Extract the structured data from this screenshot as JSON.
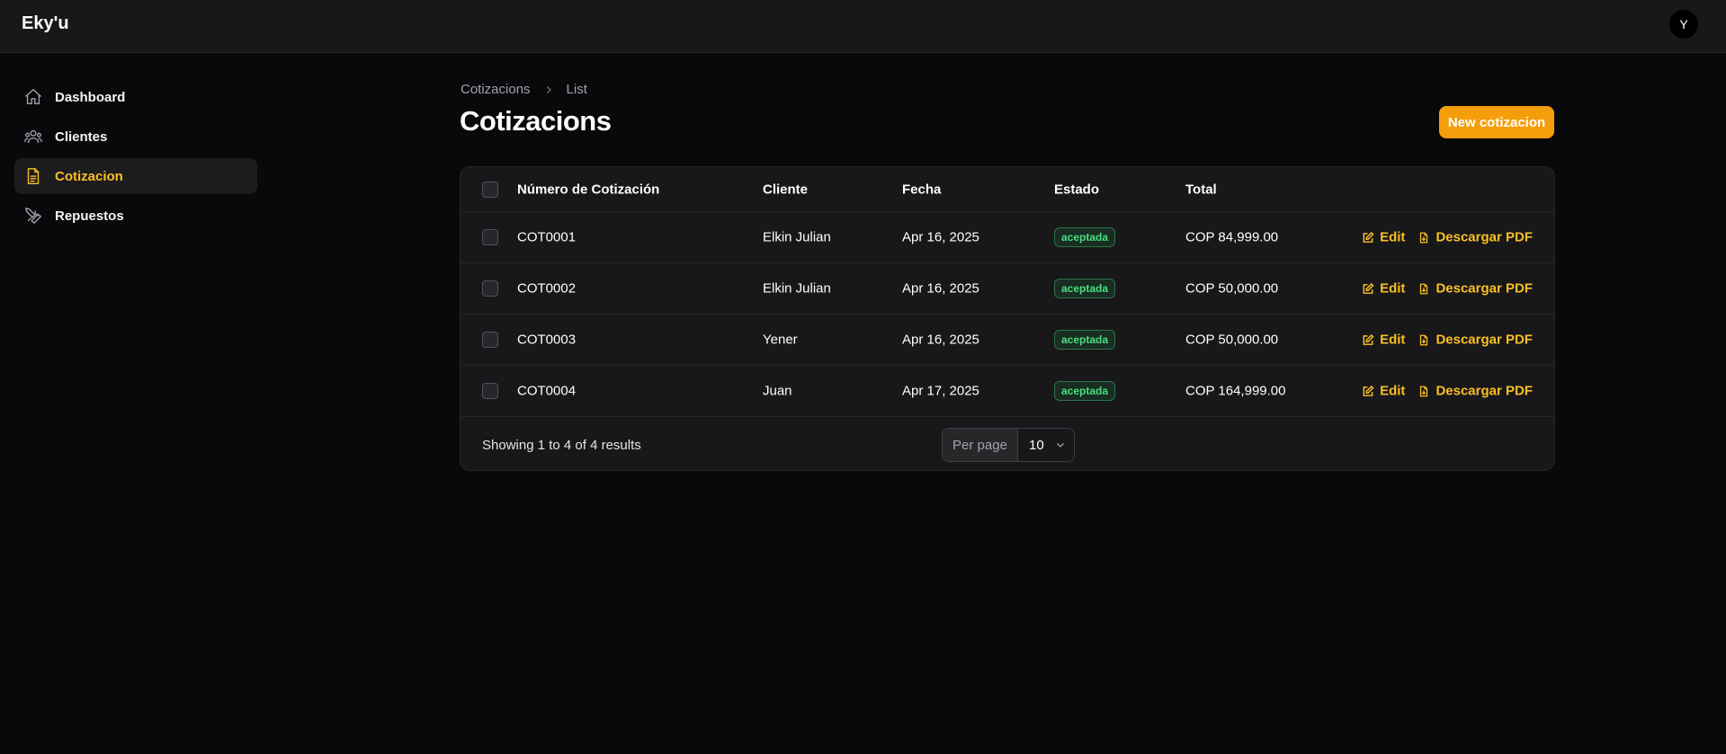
{
  "app": {
    "brand": "Eky'u",
    "user_initial": "Y"
  },
  "sidebar": {
    "items": [
      {
        "label": "Dashboard",
        "icon": "home-icon",
        "active": false
      },
      {
        "label": "Clientes",
        "icon": "users-icon",
        "active": false
      },
      {
        "label": "Cotizacion",
        "icon": "document-icon",
        "active": true
      },
      {
        "label": "Repuestos",
        "icon": "wrench-screwdriver-icon",
        "active": false
      }
    ]
  },
  "breadcrumb": {
    "parent": "Cotizacions",
    "current": "List"
  },
  "page": {
    "title": "Cotizacions",
    "new_button": "New cotizacion"
  },
  "table": {
    "columns": [
      "Número de Cotización",
      "Cliente",
      "Fecha",
      "Estado",
      "Total"
    ],
    "rows": [
      {
        "numero": "COT0001",
        "cliente": "Elkin Julian",
        "fecha": "Apr 16, 2025",
        "estado": "aceptada",
        "total": "COP 84,999.00"
      },
      {
        "numero": "COT0002",
        "cliente": "Elkin Julian",
        "fecha": "Apr 16, 2025",
        "estado": "aceptada",
        "total": "COP 50,000.00"
      },
      {
        "numero": "COT0003",
        "cliente": "Yener",
        "fecha": "Apr 16, 2025",
        "estado": "aceptada",
        "total": "COP 50,000.00"
      },
      {
        "numero": "COT0004",
        "cliente": "Juan",
        "fecha": "Apr 17, 2025",
        "estado": "aceptada",
        "total": "COP 164,999.00"
      }
    ],
    "actions": {
      "edit": "Edit",
      "download": "Descargar PDF"
    }
  },
  "pagination": {
    "summary": "Showing 1 to 4 of 4 results",
    "per_page_label": "Per page",
    "per_page_value": "10"
  },
  "colors": {
    "accent": "#f59e0b",
    "success": "#4ade80",
    "background": "#09090b",
    "surface": "#18181b"
  }
}
